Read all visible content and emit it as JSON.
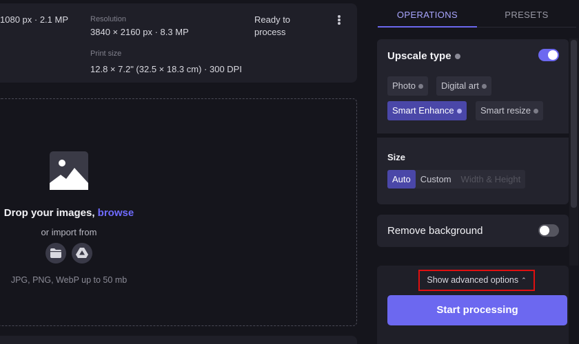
{
  "colors": {
    "accent": "#6c68f0",
    "selected_chip": "#4a47a8",
    "highlight_box": "#e01010",
    "background": "#15151c"
  },
  "file_card": {
    "original": "1080 px · 2.1 MP",
    "resolution_label": "Resolution",
    "resolution_value": "3840 × 2160 px · 8.3 MP",
    "print_size_label": "Print size",
    "print_size_value": "12.8 × 7.2\" (32.5 × 18.3 cm) · 300 DPI",
    "status": "Ready to process",
    "more_icon": "kebab-menu-icon"
  },
  "drop_zone": {
    "icon": "image-placeholder-icon",
    "title_prefix": "Drop your images, ",
    "browse": "browse",
    "import_label": "or import from",
    "import_sources": [
      "folder-icon",
      "google-drive-icon"
    ],
    "formats": "JPG, PNG, WebP up to 50 mb"
  },
  "tabs": [
    {
      "label": "OPERATIONS",
      "active": true
    },
    {
      "label": "PRESETS",
      "active": false
    }
  ],
  "upscale": {
    "title": "Upscale type",
    "enabled": true,
    "types": [
      {
        "label": "Photo",
        "selected": false
      },
      {
        "label": "Digital art",
        "selected": false
      },
      {
        "label": "Smart Enhance",
        "selected": true
      },
      {
        "label": "Smart resize",
        "selected": false
      }
    ]
  },
  "size": {
    "title": "Size",
    "options": [
      {
        "label": "Auto",
        "selected": true
      },
      {
        "label": "Custom",
        "selected": false
      },
      {
        "label": "Width & Height",
        "disabled": true
      }
    ]
  },
  "remove_background": {
    "label": "Remove background",
    "enabled": false
  },
  "advanced": {
    "label": "Show advanced options",
    "caret": "⌃"
  },
  "start_button": {
    "label": "Start processing"
  }
}
